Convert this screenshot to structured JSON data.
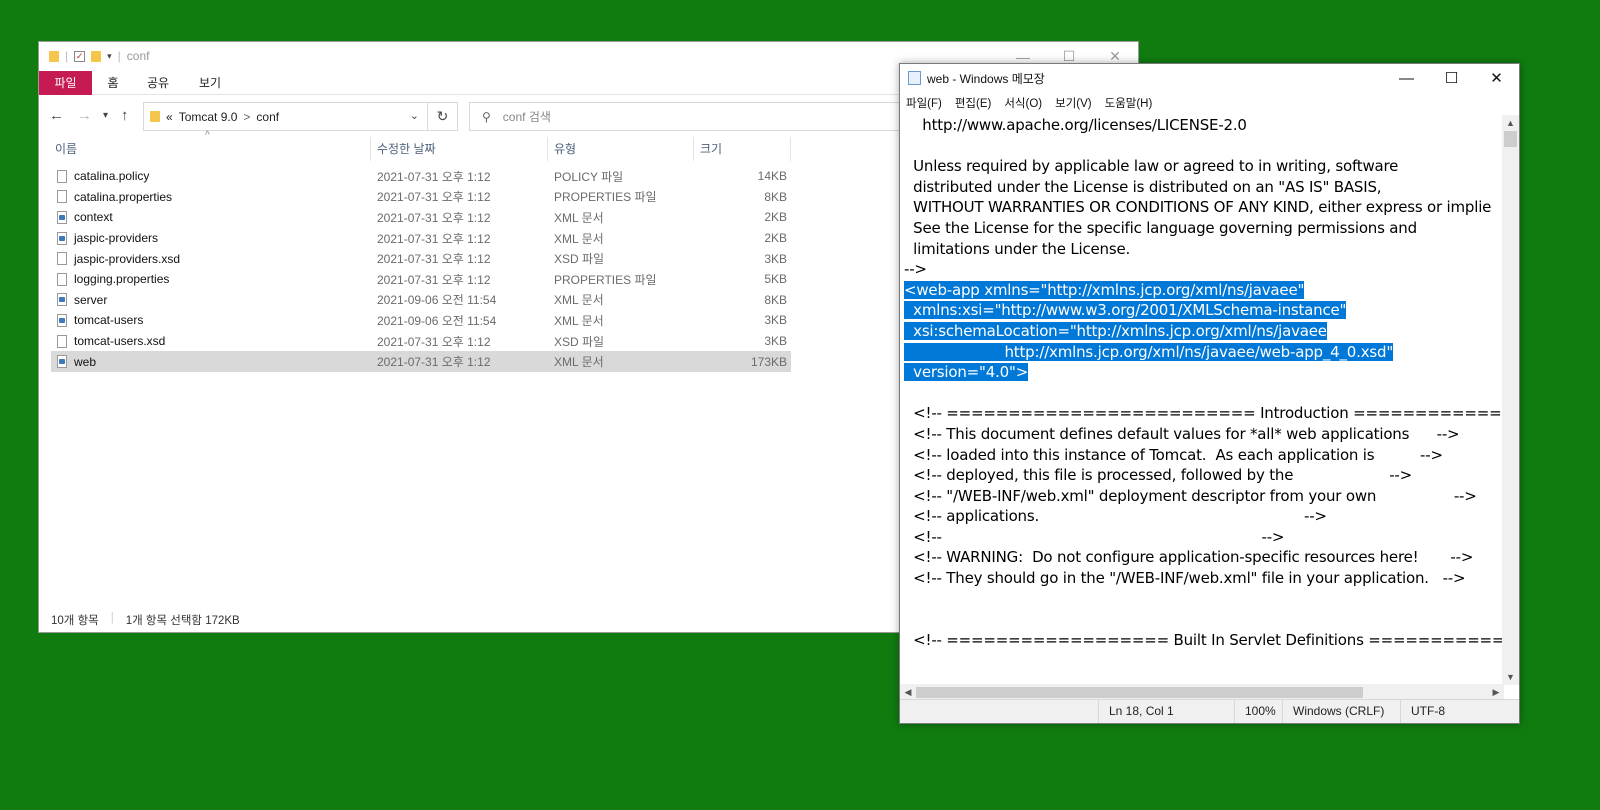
{
  "explorer": {
    "title": "conf",
    "ribbon_tabs": [
      "파일",
      "홈",
      "공유",
      "보기"
    ],
    "address": {
      "prefix": "«",
      "segments": [
        "Tomcat 9.0",
        "conf"
      ],
      "separator": ">"
    },
    "search_placeholder": "conf 검색",
    "columns": [
      "이름",
      "수정한 날짜",
      "유형",
      "크기"
    ],
    "files": [
      {
        "name": "catalina.policy",
        "date": "2021-07-31 오후 1:12",
        "type": "POLICY 파일",
        "size": "14KB",
        "icon": "file-icon"
      },
      {
        "name": "catalina.properties",
        "date": "2021-07-31 오후 1:12",
        "type": "PROPERTIES 파일",
        "size": "8KB",
        "icon": "file-icon"
      },
      {
        "name": "context",
        "date": "2021-07-31 오후 1:12",
        "type": "XML 문서",
        "size": "2KB",
        "icon": "xml-file-icon"
      },
      {
        "name": "jaspic-providers",
        "date": "2021-07-31 오후 1:12",
        "type": "XML 문서",
        "size": "2KB",
        "icon": "xml-file-icon"
      },
      {
        "name": "jaspic-providers.xsd",
        "date": "2021-07-31 오후 1:12",
        "type": "XSD 파일",
        "size": "3KB",
        "icon": "file-icon"
      },
      {
        "name": "logging.properties",
        "date": "2021-07-31 오후 1:12",
        "type": "PROPERTIES 파일",
        "size": "5KB",
        "icon": "file-icon"
      },
      {
        "name": "server",
        "date": "2021-09-06 오전 11:54",
        "type": "XML 문서",
        "size": "8KB",
        "icon": "xml-file-icon"
      },
      {
        "name": "tomcat-users",
        "date": "2021-09-06 오전 11:54",
        "type": "XML 문서",
        "size": "3KB",
        "icon": "xml-file-icon"
      },
      {
        "name": "tomcat-users.xsd",
        "date": "2021-07-31 오후 1:12",
        "type": "XSD 파일",
        "size": "3KB",
        "icon": "file-icon"
      },
      {
        "name": "web",
        "date": "2021-07-31 오후 1:12",
        "type": "XML 문서",
        "size": "173KB",
        "icon": "xml-file-icon",
        "selected": true
      }
    ],
    "status": {
      "item_count": "10개 항목",
      "selection": "1개 항목 선택함 172KB"
    }
  },
  "notepad": {
    "title": "web - Windows 메모장",
    "menu": [
      "파일(F)",
      "편집(E)",
      "서식(O)",
      "보기(V)",
      "도움말(H)"
    ],
    "lines": [
      {
        "text": "    http://www.apache.org/licenses/LICENSE-2.0"
      },
      {
        "text": ""
      },
      {
        "text": "  Unless required by applicable law or agreed to in writing, software"
      },
      {
        "text": "  distributed under the License is distributed on an \"AS IS\" BASIS,"
      },
      {
        "text": "  WITHOUT WARRANTIES OR CONDITIONS OF ANY KIND, either express or implie"
      },
      {
        "text": "  See the License for the specific language governing permissions and"
      },
      {
        "text": "  limitations under the License."
      },
      {
        "text": "-->"
      },
      {
        "text": "<web-app xmlns=\"http://xmlns.jcp.org/xml/ns/javaee\"",
        "selected": true
      },
      {
        "text": "  xmlns:xsi=\"http://www.w3.org/2001/XMLSchema-instance\"",
        "selected": true
      },
      {
        "text": "  xsi:schemaLocation=\"http://xmlns.jcp.org/xml/ns/javaee",
        "selected": true
      },
      {
        "text": "                      http://xmlns.jcp.org/xml/ns/javaee/web-app_4_0.xsd\"",
        "selected": true
      },
      {
        "text": "  version=\"4.0\">",
        "selected": true
      },
      {
        "text": ""
      },
      {
        "text": "  <!-- ========================= Introduction ===================="
      },
      {
        "text": "  <!-- This document defines default values for *all* web applications      -->"
      },
      {
        "text": "  <!-- loaded into this instance of Tomcat.  As each application is          -->"
      },
      {
        "text": "  <!-- deployed, this file is processed, followed by the                     -->"
      },
      {
        "text": "  <!-- \"/WEB-INF/web.xml\" deployment descriptor from your own                 -->"
      },
      {
        "text": "  <!-- applications.                                                          -->"
      },
      {
        "text": "  <!--                                                                      -->"
      },
      {
        "text": "  <!-- WARNING:  Do not configure application-specific resources here!       -->"
      },
      {
        "text": "  <!-- They should go in the \"/WEB-INF/web.xml\" file in your application.   -->"
      },
      {
        "text": ""
      },
      {
        "text": ""
      },
      {
        "text": "  <!-- ================== Built In Servlet Definitions ================"
      }
    ],
    "status": {
      "position": "Ln 18, Col 1",
      "zoom": "100%",
      "line_ending": "Windows (CRLF)",
      "encoding": "UTF-8"
    }
  },
  "colors": {
    "desktop": "#107c10",
    "selection": "#0078d7",
    "file_tab": "#c51a52"
  }
}
